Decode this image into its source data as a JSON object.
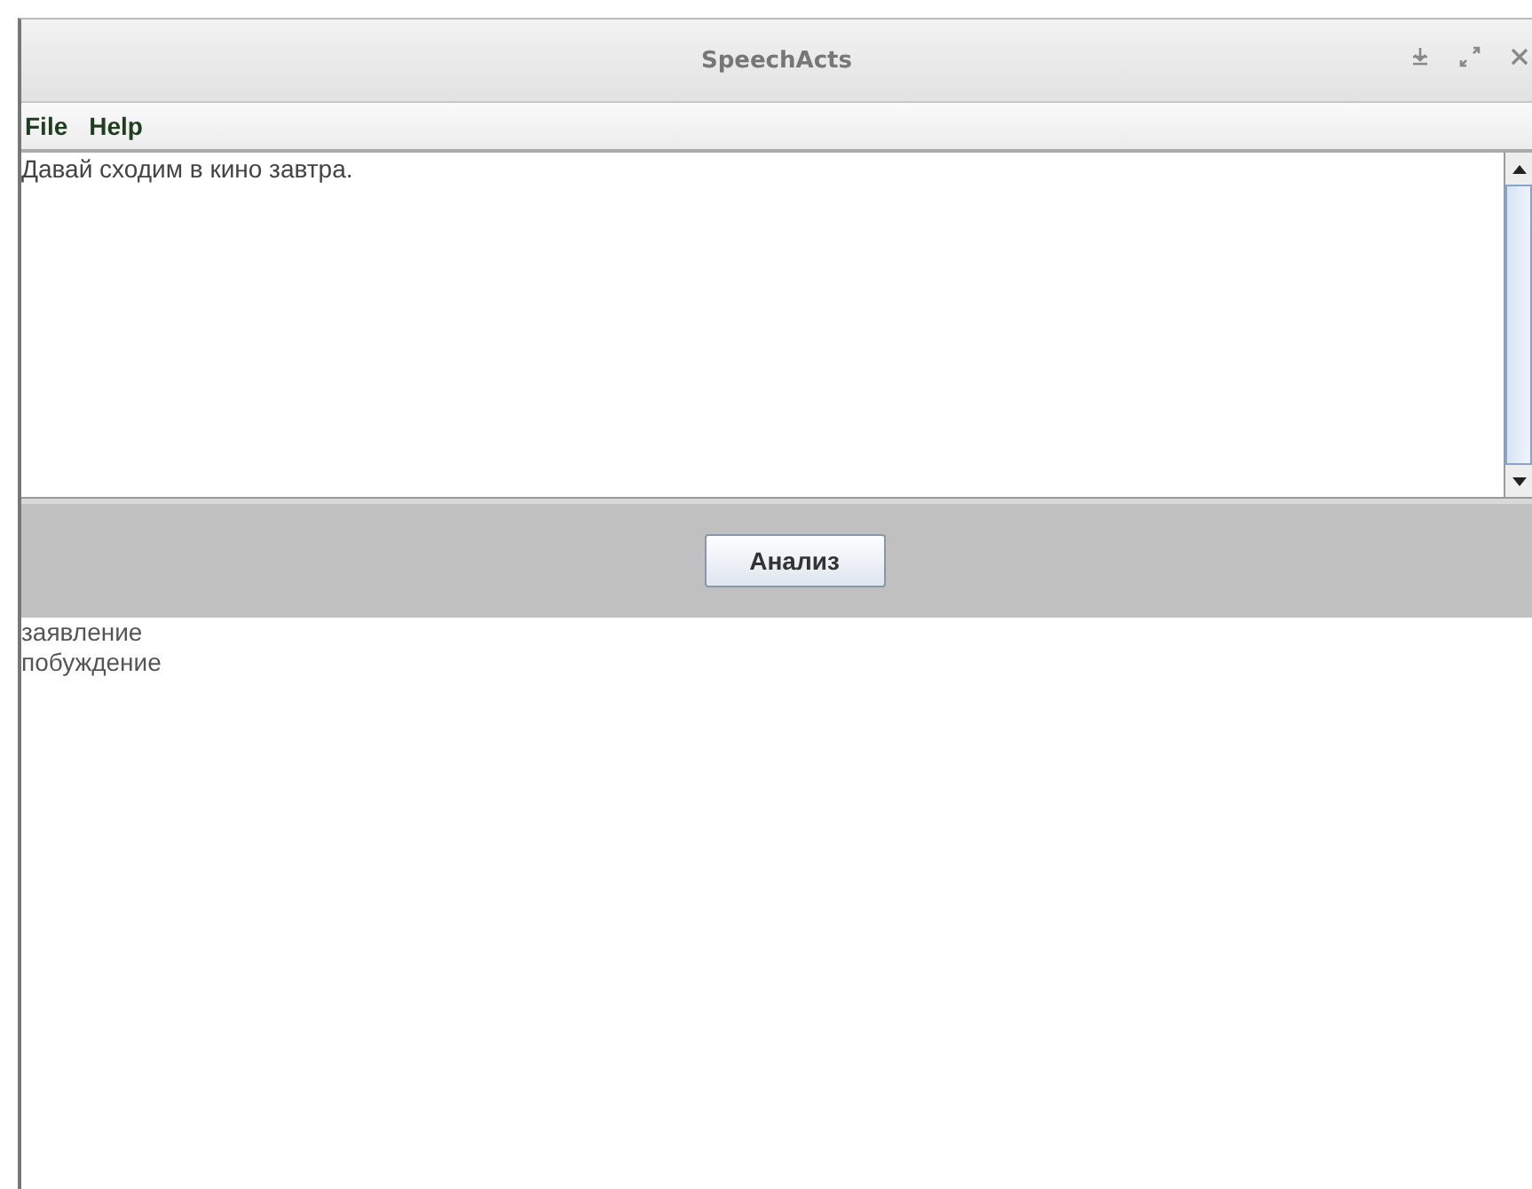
{
  "window": {
    "title": "SpeechActs"
  },
  "menu": [
    {
      "label": "File"
    },
    {
      "label": "Help"
    }
  ],
  "input": {
    "value": "Давай сходим в кино завтра."
  },
  "button": {
    "label": "Анализ"
  },
  "output": {
    "lines": [
      "заявление",
      "побуждение"
    ]
  }
}
